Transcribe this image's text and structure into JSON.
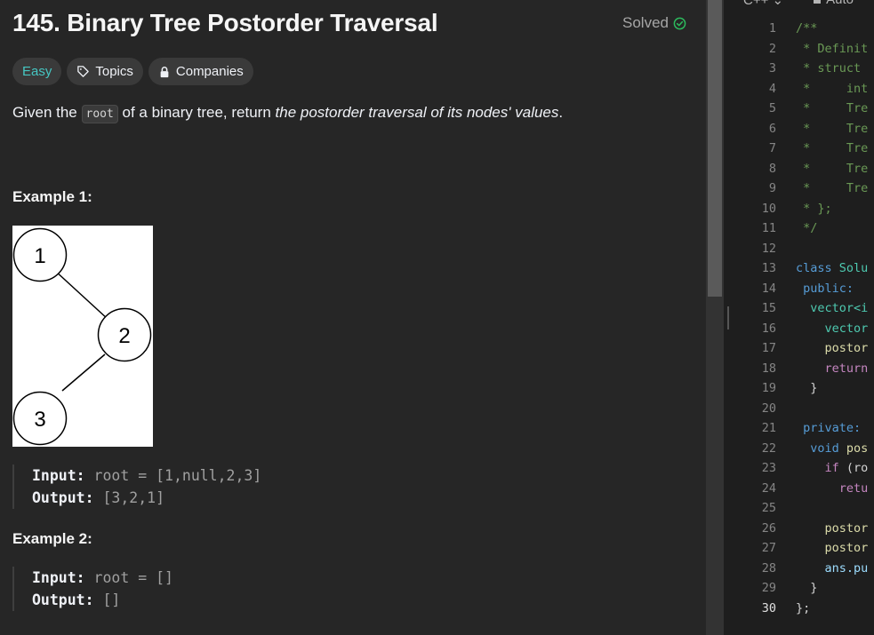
{
  "problem": {
    "title": "145. Binary Tree Postorder Traversal",
    "status": "Solved",
    "tags": {
      "difficulty": "Easy",
      "topics": "Topics",
      "companies": "Companies"
    },
    "desc_pre": "Given the ",
    "desc_code": "root",
    "desc_mid": " of a binary tree, return ",
    "desc_em": "the postorder traversal of its nodes' values",
    "desc_end": ".",
    "examples": [
      {
        "heading": "Example 1:",
        "tree_nodes": [
          "1",
          "2",
          "3"
        ],
        "input_label": "Input:",
        "input_value": "root = [1,null,2,3]",
        "output_label": "Output:",
        "output_value": "[3,2,1]"
      },
      {
        "heading": "Example 2:",
        "input_label": "Input:",
        "input_value": "root = []",
        "output_label": "Output:",
        "output_value": "[]"
      }
    ]
  },
  "editor": {
    "language": "C++",
    "mode": "Auto",
    "current_line": 30,
    "lines": [
      {
        "n": "1",
        "t": "/**",
        "c": "com",
        "i": 0
      },
      {
        "n": "2",
        "t": " * Definit",
        "c": "com",
        "i": 0
      },
      {
        "n": "3",
        "t": " * struct ",
        "c": "com",
        "i": 0
      },
      {
        "n": "4",
        "t": " *     int",
        "c": "com",
        "i": 0
      },
      {
        "n": "5",
        "t": " *     Tre",
        "c": "com",
        "i": 0
      },
      {
        "n": "6",
        "t": " *     Tre",
        "c": "com",
        "i": 0
      },
      {
        "n": "7",
        "t": " *     Tre",
        "c": "com",
        "i": 0
      },
      {
        "n": "8",
        "t": " *     Tre",
        "c": "com",
        "i": 0
      },
      {
        "n": "9",
        "t": " *     Tre",
        "c": "com",
        "i": 0
      },
      {
        "n": "10",
        "t": " * };",
        "c": "com",
        "i": 0
      },
      {
        "n": "11",
        "t": " */",
        "c": "com",
        "i": 0
      },
      {
        "n": "12",
        "t": "",
        "c": "plain",
        "i": 0
      },
      {
        "n": "13",
        "t": "class ",
        "c": "kw",
        "t2": "Solu",
        "c2": "type",
        "i": 0
      },
      {
        "n": "14",
        "t": " public:",
        "c": "kw",
        "i": 0
      },
      {
        "n": "15",
        "t": "  vector<i",
        "c": "type",
        "i": 0
      },
      {
        "n": "16",
        "t": "    vector",
        "c": "type",
        "i": 0
      },
      {
        "n": "17",
        "t": "    postor",
        "c": "fn",
        "i": 0
      },
      {
        "n": "18",
        "t": "    return",
        "c": "kw2",
        "i": 0
      },
      {
        "n": "19",
        "t": "  }",
        "c": "plain",
        "i": 0
      },
      {
        "n": "20",
        "t": "",
        "c": "plain",
        "i": 0
      },
      {
        "n": "21",
        "t": " private:",
        "c": "kw",
        "i": 0
      },
      {
        "n": "22",
        "t": "  void ",
        "c": "kw",
        "t2": "pos",
        "c2": "fn",
        "i": 0
      },
      {
        "n": "23",
        "t": "    if ",
        "c": "kw2",
        "t2": "(ro",
        "c2": "plain",
        "i": 0
      },
      {
        "n": "24",
        "t": "      retu",
        "c": "kw2",
        "i": 0
      },
      {
        "n": "25",
        "t": "",
        "c": "plain",
        "i": 0
      },
      {
        "n": "26",
        "t": "    postor",
        "c": "fn",
        "i": 0
      },
      {
        "n": "27",
        "t": "    postor",
        "c": "fn",
        "i": 0
      },
      {
        "n": "28",
        "t": "    ans.pu",
        "c": "var",
        "i": 0
      },
      {
        "n": "29",
        "t": "  }",
        "c": "plain",
        "i": 0
      },
      {
        "n": "30",
        "t": "};",
        "c": "plain",
        "i": 0
      }
    ]
  },
  "colors": {
    "easy": "#46c6c2",
    "solved_check": "#2cbb5d",
    "background": "#262626",
    "editor_background": "#1e1e1e"
  }
}
